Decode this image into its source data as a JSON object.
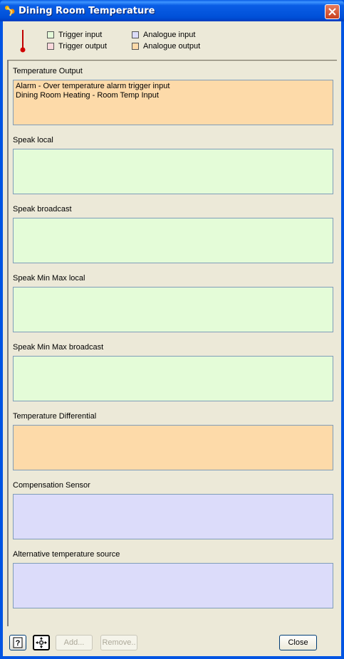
{
  "window": {
    "title": "Dining Room Temperature"
  },
  "legend": {
    "items": [
      {
        "label": "Trigger input",
        "color": "#e4f9d8"
      },
      {
        "label": "Trigger output",
        "color": "#fbd8dc"
      },
      {
        "label": "Analogue input",
        "color": "#dcdcfa"
      },
      {
        "label": "Analogue output",
        "color": "#fddaa9"
      }
    ]
  },
  "sections": [
    {
      "label": "Temperature Output",
      "color": "#fddaa9",
      "lines": [
        "Alarm - Over temperature alarm trigger input",
        "Dining Room Heating - Room Temp Input"
      ]
    },
    {
      "label": "Speak local",
      "color": "#e4fcd8",
      "lines": []
    },
    {
      "label": "Speak broadcast",
      "color": "#e4fcd8",
      "lines": []
    },
    {
      "label": "Speak Min Max local",
      "color": "#e4fcd8",
      "lines": []
    },
    {
      "label": "Speak Min Max broadcast",
      "color": "#e4fcd8",
      "lines": []
    },
    {
      "label": "Temperature Differential",
      "color": "#fddaa9",
      "lines": []
    },
    {
      "label": "Compensation Sensor",
      "color": "#dcdcfa",
      "lines": []
    },
    {
      "label": "Alternative temperature source",
      "color": "#dcdcfa",
      "lines": []
    }
  ],
  "buttons": {
    "help_icon": "help-icon",
    "move_icon": "move-icon",
    "add_label": "Add...",
    "remove_label": "Remove..",
    "close_label": "Close"
  }
}
